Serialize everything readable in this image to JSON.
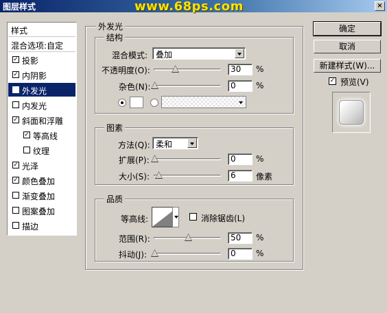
{
  "window": {
    "title": "图层样式",
    "watermark": "www.68ps.com",
    "close": "×"
  },
  "left_panel": {
    "header": "样式",
    "blend_options": "混合选项:自定",
    "items": [
      {
        "label": "投影",
        "checked": true
      },
      {
        "label": "内阴影",
        "checked": true
      },
      {
        "label": "外发光",
        "checked": true,
        "selected": true
      },
      {
        "label": "内发光",
        "checked": false
      },
      {
        "label": "斜面和浮雕",
        "checked": true
      },
      {
        "label": "等高线",
        "checked": true,
        "indent": true
      },
      {
        "label": "纹理",
        "checked": false,
        "indent": true
      },
      {
        "label": "光泽",
        "checked": true
      },
      {
        "label": "颜色叠加",
        "checked": true
      },
      {
        "label": "渐变叠加",
        "checked": false
      },
      {
        "label": "图案叠加",
        "checked": false
      },
      {
        "label": "描边",
        "checked": false
      }
    ]
  },
  "buttons": {
    "ok": "确定",
    "cancel": "取消",
    "new_style": "新建样式(W)...",
    "preview": "预览(V)",
    "preview_checked": true
  },
  "outer_glow": {
    "title": "外发光",
    "structure": {
      "title": "结构",
      "blend_mode_label": "混合模式:",
      "blend_mode_value": "叠加",
      "opacity_label": "不透明度(O):",
      "opacity_value": "30",
      "noise_label": "杂色(N):",
      "noise_value": "0",
      "percent": "%"
    },
    "elements": {
      "title": "图素",
      "technique_label": "方法(Q):",
      "technique_value": "柔和",
      "spread_label": "扩展(P):",
      "spread_value": "0",
      "size_label": "大小(S):",
      "size_value": "6",
      "percent": "%",
      "px": "像素"
    },
    "quality": {
      "title": "品质",
      "contour_label": "等高线:",
      "anti_alias_label": "消除锯齿(L)",
      "anti_alias_checked": false,
      "range_label": "范围(R):",
      "range_value": "50",
      "jitter_label": "抖动(J):",
      "jitter_value": "0",
      "percent": "%"
    }
  }
}
